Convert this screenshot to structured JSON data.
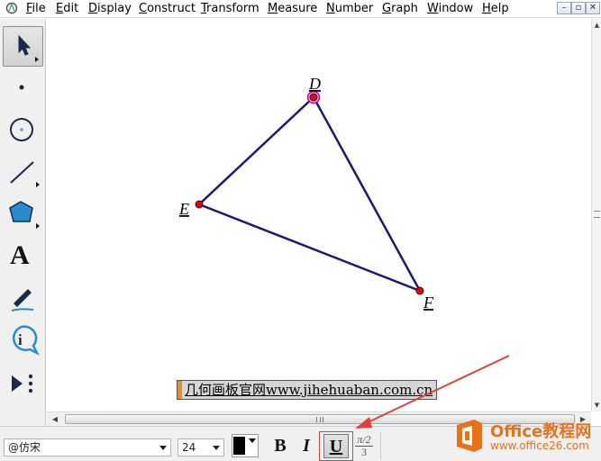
{
  "menu": {
    "items": [
      {
        "pre": "",
        "u": "F",
        "post": "ile"
      },
      {
        "pre": "",
        "u": "E",
        "post": "dit"
      },
      {
        "pre": "",
        "u": "D",
        "post": "isplay"
      },
      {
        "pre": "",
        "u": "C",
        "post": "onstruct"
      },
      {
        "pre": "",
        "u": "T",
        "post": "ransform"
      },
      {
        "pre": "",
        "u": "M",
        "post": "easure"
      },
      {
        "pre": "",
        "u": "N",
        "post": "umber"
      },
      {
        "pre": "",
        "u": "G",
        "post": "raph"
      },
      {
        "pre": "",
        "u": "W",
        "post": "indow"
      },
      {
        "pre": "",
        "u": "H",
        "post": "elp"
      }
    ],
    "window_controls": [
      "–",
      "▫",
      "✕"
    ]
  },
  "toolbox": {
    "tools": [
      "arrow-tool",
      "point-tool",
      "compass-tool",
      "straightedge-tool",
      "polygon-tool",
      "text-tool",
      "marker-tool",
      "information-tool",
      "custom-tool"
    ],
    "text_tool_glyph": "A",
    "active_tool": "arrow-tool"
  },
  "sketch": {
    "labels": {
      "D": "D",
      "E": "E",
      "F": "F"
    },
    "segment_color": "#1a1a6e",
    "point_color": "#cc1111",
    "selected_point_color": "#c000c0",
    "caption_text": "几何画板官网www.jihehuaban.com.cn"
  },
  "format_bar": {
    "font_name": "@仿宋",
    "font_size": "24",
    "text_color": "#000000",
    "bold_label": "B",
    "italic_label": "I",
    "underline_label": "U",
    "math_numerator": "π/2",
    "math_denominator": "3",
    "underline_active": true
  },
  "watermark": {
    "title": "Office教程网",
    "url": "www.office26.com",
    "color": "#e8711b"
  },
  "scrollbar_glyphs": {
    "grip": "|||"
  }
}
